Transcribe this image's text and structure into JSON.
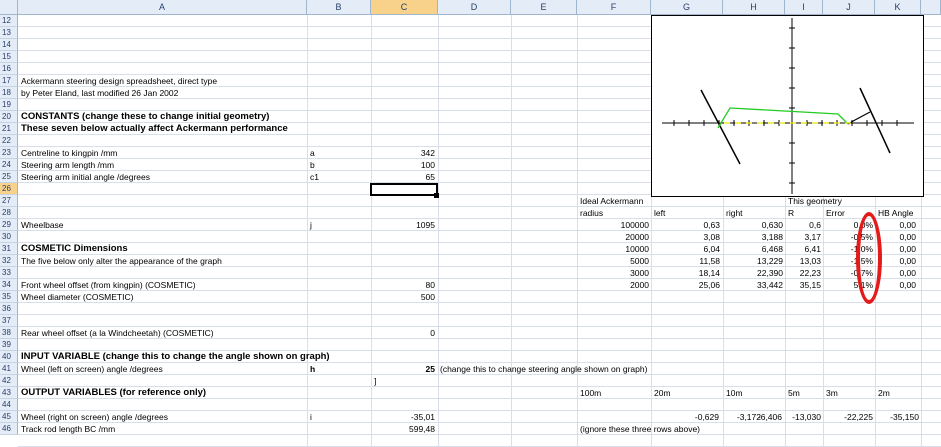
{
  "columns": [
    "A",
    "B",
    "C",
    "D",
    "E",
    "F",
    "G",
    "H",
    "I",
    "J",
    "K"
  ],
  "selected_column": "C",
  "rows": [
    "12",
    "13",
    "14",
    "15",
    "16",
    "17",
    "18",
    "19",
    "20",
    "21",
    "22",
    "23",
    "24",
    "25",
    "26",
    "27",
    "28",
    "29",
    "30",
    "31",
    "32",
    "33",
    "34",
    "35",
    "36",
    "37",
    "38",
    "39",
    "40",
    "41",
    "42",
    "43",
    "44",
    "45",
    "46"
  ],
  "selected_row": "26",
  "cells": {
    "a17": "Ackermann steering design spreadsheet, direct type",
    "a18": "by Peter Eland, last modified 26 Jan 2002",
    "a20": "CONSTANTS (change these to change initial geometry)",
    "a21": "These seven below actually affect Ackermann performance",
    "a23": "Centreline to kingpin /mm",
    "b23": "a",
    "c23": "342",
    "a24": "Steering arm length /mm",
    "b24": "b",
    "c24": "100",
    "a25": "Steering arm initial angle /degrees",
    "b25": "c1",
    "c25": "65",
    "f27": "Ideal Ackermann",
    "i27": "This geometry",
    "f28": "radius",
    "g28": "left",
    "h28": "right",
    "i28": "R",
    "j28": "Error",
    "k28": "HB Angle",
    "a29": "Wheelbase",
    "b29": "j",
    "c29": "1095",
    "a31": "COSMETIC Dimensions",
    "a32": "The five below only alter the appearance of the graph",
    "a34": "Front wheel offset (from kingpin) (COSMETIC)",
    "c34": "80",
    "a35": "Wheel diameter (COSMETIC)",
    "c35": "500",
    "a38": "Rear wheel offset (a la Windcheetah) (COSMETIC)",
    "c38": "0",
    "a40": "INPUT VARIABLE (change this to change the angle shown on graph)",
    "a41": "Wheel (left on screen) angle /degrees",
    "b41": "h",
    "c41": "25",
    "d41": "(change this to change steering angle shown on graph)",
    "c42": "]",
    "a43": "OUTPUT VARIABLES (for reference only)",
    "a45": "Wheel (right on screen) angle /degrees",
    "b45": "i",
    "c45": "-35,01",
    "a46": "Track rod length BC /mm",
    "c46": "599,48",
    "f46": "(ignore these three rows above)"
  },
  "ackermann_table": [
    {
      "radius": "100000",
      "left": "0,63",
      "right": "0,630",
      "R": "0,6",
      "error": "0,0%",
      "hb": "0,00"
    },
    {
      "radius": "20000",
      "left": "3,08",
      "right": "3,188",
      "R": "3,17",
      "error": "-0,5%",
      "hb": "0,00"
    },
    {
      "radius": "10000",
      "left": "6,04",
      "right": "6,468",
      "R": "6,41",
      "error": "-1,0%",
      "hb": "0,00"
    },
    {
      "radius": "5000",
      "left": "11,58",
      "right": "13,229",
      "R": "13,03",
      "error": "-1,5%",
      "hb": "0,00"
    },
    {
      "radius": "3000",
      "left": "18,14",
      "right": "22,390",
      "R": "22,23",
      "error": "-0,7%",
      "hb": "0,00"
    },
    {
      "radius": "2000",
      "left": "25,06",
      "right": "33,442",
      "R": "35,15",
      "error": "5,1%",
      "hb": "0,00"
    }
  ],
  "row43_labels": {
    "f": "100m",
    "g": "20m",
    "h": "10m",
    "i": "5m",
    "j": "3m",
    "k": "2m"
  },
  "row45_values": {
    "g": "-0,629",
    "h": "-3,172",
    "h2": "-6,406",
    "i": "-13,030",
    "j": "-22,225",
    "k": "-35,150"
  },
  "colors": {
    "highlight": "#e31b1b",
    "header_bg": "#e4ecf7",
    "selected_header": "#f8d28a",
    "chart_green": "#22cc22",
    "chart_yellow": "#e6e600"
  }
}
